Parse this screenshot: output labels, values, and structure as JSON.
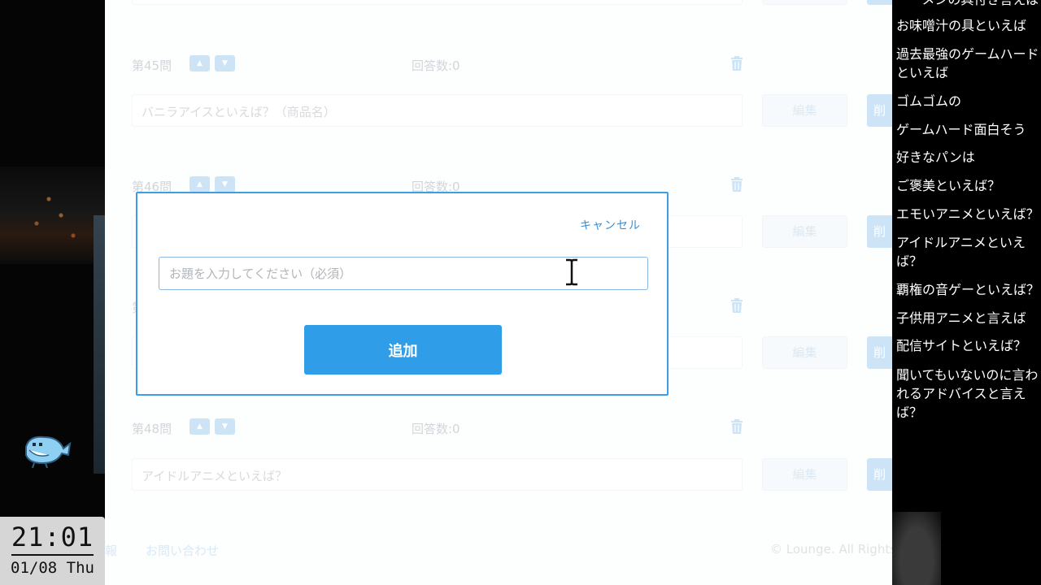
{
  "overlay": {
    "clock_time": "21:01",
    "clock_date": "01/08 Thu"
  },
  "questions": [
    {
      "num": "第45問",
      "answers": "回答数:0",
      "text": "バニラアイスといえば？（商品名）",
      "edit": "編集"
    },
    {
      "num": "第46問",
      "answers": "回答数:0",
      "text": "",
      "edit": "編集"
    },
    {
      "num": "第",
      "answers": "",
      "text": "",
      "edit": "編集"
    },
    {
      "num": "第48問",
      "answers": "回答数:0",
      "text": "アイドルアニメといえば？",
      "edit": "編集"
    }
  ],
  "side_button_label": "削",
  "footer": {
    "left_link": "報",
    "contact": "お問い合わせ",
    "copyright": "© Lounge. All Rights"
  },
  "modal": {
    "cancel": "キャンセル",
    "input_placeholder": "お題を入力してください（必須）",
    "input_value": "",
    "add": "追加"
  },
  "comments": [
    "ーーメンの具付き言えば",
    "お味噌汁の具といえば",
    "過去最強のゲームハード",
    "といえば",
    "ゴムゴムの",
    "ゲームハード面白そう",
    "好きなパンは",
    "ご褒美といえば？",
    "エモいアニメといえば？",
    "アイドルアニメといえ",
    "ば？",
    "覇権の音ゲーといえば？",
    "子供用アニメと言えば",
    "配信サイトといえば？",
    "聞いてもいないのに言わ",
    "れるアドバイスと言え",
    "ば？"
  ],
  "colors": {
    "accent": "#2f9de8",
    "modal_border": "#3d9ee6",
    "link": "#3a8fd4"
  }
}
